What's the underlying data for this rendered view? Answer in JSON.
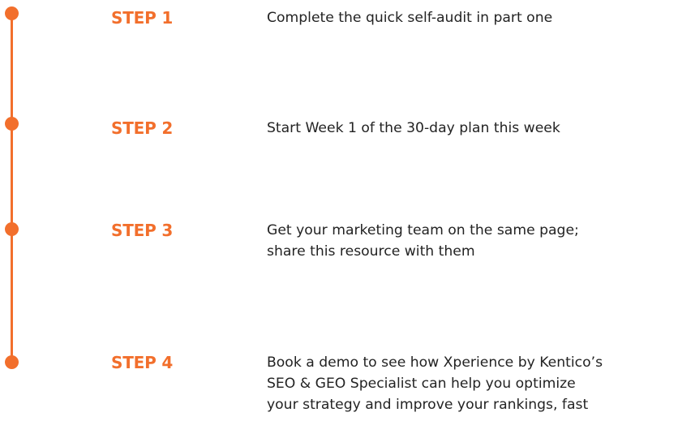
{
  "accent_color": "#f26f2c",
  "text_color": "#232323",
  "steps": [
    {
      "label": "STEP 1",
      "lines": [
        "Complete the quick self-audit in part one"
      ]
    },
    {
      "label": "STEP 2",
      "lines": [
        "Start Week 1 of the 30-day plan this week"
      ]
    },
    {
      "label": "STEP 3",
      "lines": [
        "Get your marketing team on the same page;",
        "share this resource with them"
      ]
    },
    {
      "label": "STEP 4",
      "lines": [
        "Book a demo to see how Xperience by Kentico’s",
        "SEO & GEO Specialist can help you optimize",
        "your strategy and improve your rankings, fast"
      ]
    }
  ]
}
